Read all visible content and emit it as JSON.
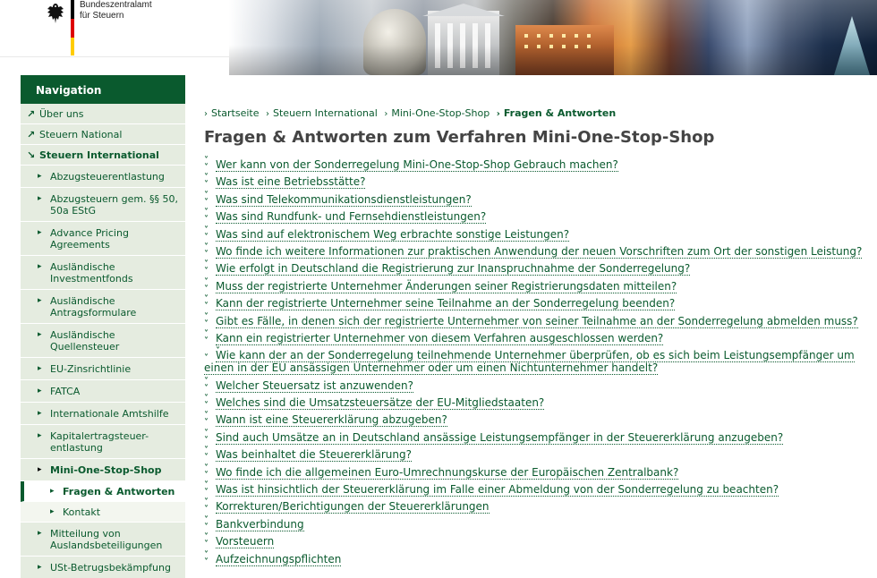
{
  "header": {
    "agency_line1": "Bundeszentralamt",
    "agency_line2": "für Steuern"
  },
  "nav": {
    "title": "Navigation",
    "top_items": [
      {
        "label": "Über uns"
      },
      {
        "label": "Steuern National"
      },
      {
        "label": "Steuern International"
      }
    ],
    "sub_items": [
      {
        "label": "Abzugsteuerentlastung"
      },
      {
        "label": "Abzugsteuern gem. §§ 50, 50a EStG"
      },
      {
        "label": "Advance Pricing Agreements"
      },
      {
        "label": "Ausländische Investmentfonds"
      },
      {
        "label": "Ausländische Antragsformulare"
      },
      {
        "label": "Ausländische Quellensteuer"
      },
      {
        "label": "EU-Zinsrichtlinie"
      },
      {
        "label": "FATCA"
      },
      {
        "label": "Internationale Amtshilfe"
      },
      {
        "label": "Kapitalertragsteuer-entlastung"
      },
      {
        "label": "Mini-One-Stop-Shop"
      }
    ],
    "sub3_items": [
      {
        "label": "Fragen & Antworten"
      },
      {
        "label": "Kontakt"
      }
    ],
    "after_items": [
      {
        "label": "Mitteilung von Auslandsbeteiligungen"
      },
      {
        "label": "USt-Betrugsbekämpfung"
      }
    ]
  },
  "breadcrumb": [
    "Startseite",
    "Steuern International",
    "Mini-One-Stop-Shop",
    "Fragen & Antworten"
  ],
  "page_title": "Fragen & Antworten zum Verfahren Mini-One-Stop-Shop",
  "faq": [
    "Wer kann von der Sonderregelung Mini-One-Stop-Shop Gebrauch machen?",
    "Was ist eine Betriebsstätte?",
    "Was sind Telekommunikationsdienstleistungen?",
    "Was sind Rundfunk- und Fernsehdienstleistungen?",
    "Was sind auf elektronischem Weg erbrachte sonstige Leistungen?",
    "Wo finde ich weitere Informationen zur praktischen Anwendung der neuen Vorschriften zum Ort der sonstigen Leistung?",
    "Wie erfolgt in Deutschland die Registrierung zur Inanspruchnahme der Sonderregelung?",
    "Muss der registrierte Unternehmer Änderungen seiner Registrierungsdaten mitteilen?",
    "Kann der registrierte Unternehmer seine Teilnahme an der Sonderregelung beenden?",
    "Gibt es Fälle, in denen sich der registrierte Unternehmer von seiner Teilnahme an der Sonderregelung abmelden muss?",
    "Kann ein registrierter Unternehmer von diesem Verfahren ausgeschlossen werden?",
    "Wie kann der an der Sonderregelung teilnehmende Unternehmer überprüfen, ob es sich beim Leistungsempfänger um einen in der EU ansässigen Unternehmer oder um einen Nichtunternehmer handelt?",
    "Welcher Steuersatz ist anzuwenden?",
    "Welches sind die Umsatzsteuersätze der EU-Mitgliedstaaten?",
    "Wann ist eine Steuererklärung abzugeben?",
    "Sind auch Umsätze an in Deutschland ansässige Leistungsempfänger in der Steuererklärung anzugeben?",
    "Was beinhaltet die Steuererklärung?",
    "Wo finde ich die allgemeinen Euro-Umrechnungskurse der Europäischen Zentralbank?",
    "Was ist hinsichtlich der Steuererklärung im Falle einer Abmeldung von der Sonderregelung zu beachten?",
    "Korrekturen/Berichtigungen der Steuererklärungen",
    "Bankverbindung",
    "Vorsteuern",
    "Aufzeichnungspflichten"
  ]
}
